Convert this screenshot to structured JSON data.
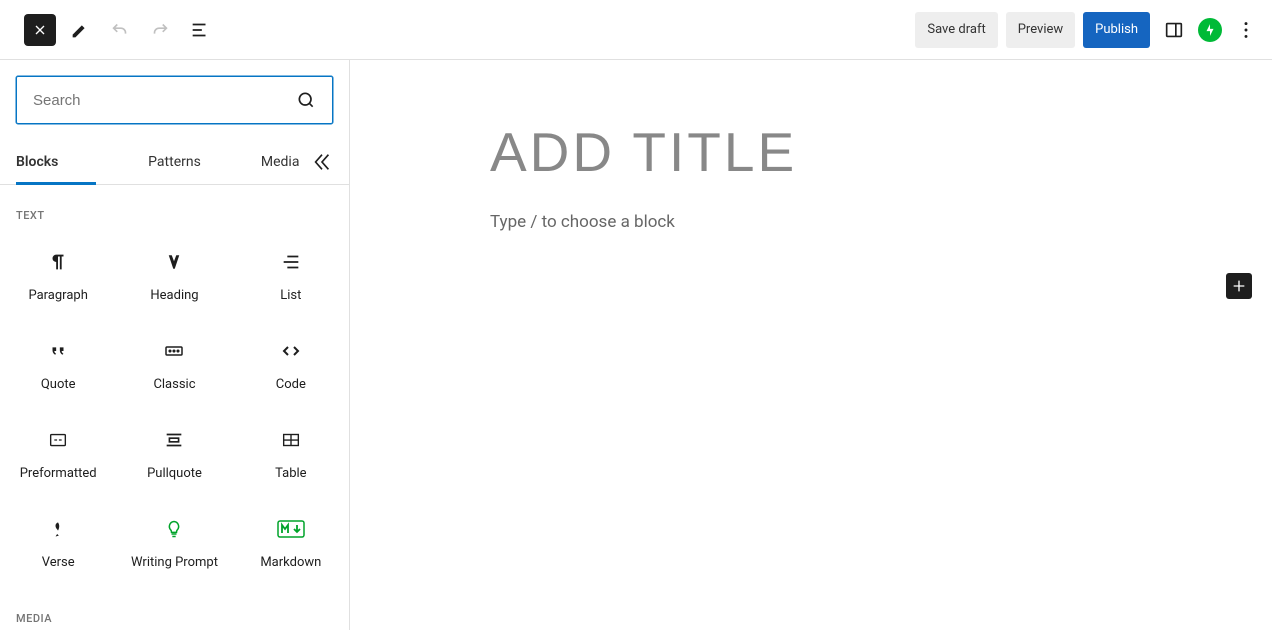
{
  "toolbar": {
    "save_draft": "Save draft",
    "preview": "Preview",
    "publish": "Publish"
  },
  "inserter": {
    "search_placeholder": "Search",
    "tabs": {
      "blocks": "Blocks",
      "patterns": "Patterns",
      "media": "Media"
    },
    "sections": {
      "text": {
        "title": "TEXT",
        "items": {
          "paragraph": "Paragraph",
          "heading": "Heading",
          "list": "List",
          "quote": "Quote",
          "classic": "Classic",
          "code": "Code",
          "preformatted": "Preformatted",
          "pullquote": "Pullquote",
          "table": "Table",
          "verse": "Verse",
          "writing_prompt": "Writing Prompt",
          "markdown": "Markdown"
        }
      },
      "media": {
        "title": "MEDIA"
      }
    }
  },
  "editor": {
    "title_placeholder": "Add title",
    "body_placeholder": "Type / to choose a block"
  }
}
